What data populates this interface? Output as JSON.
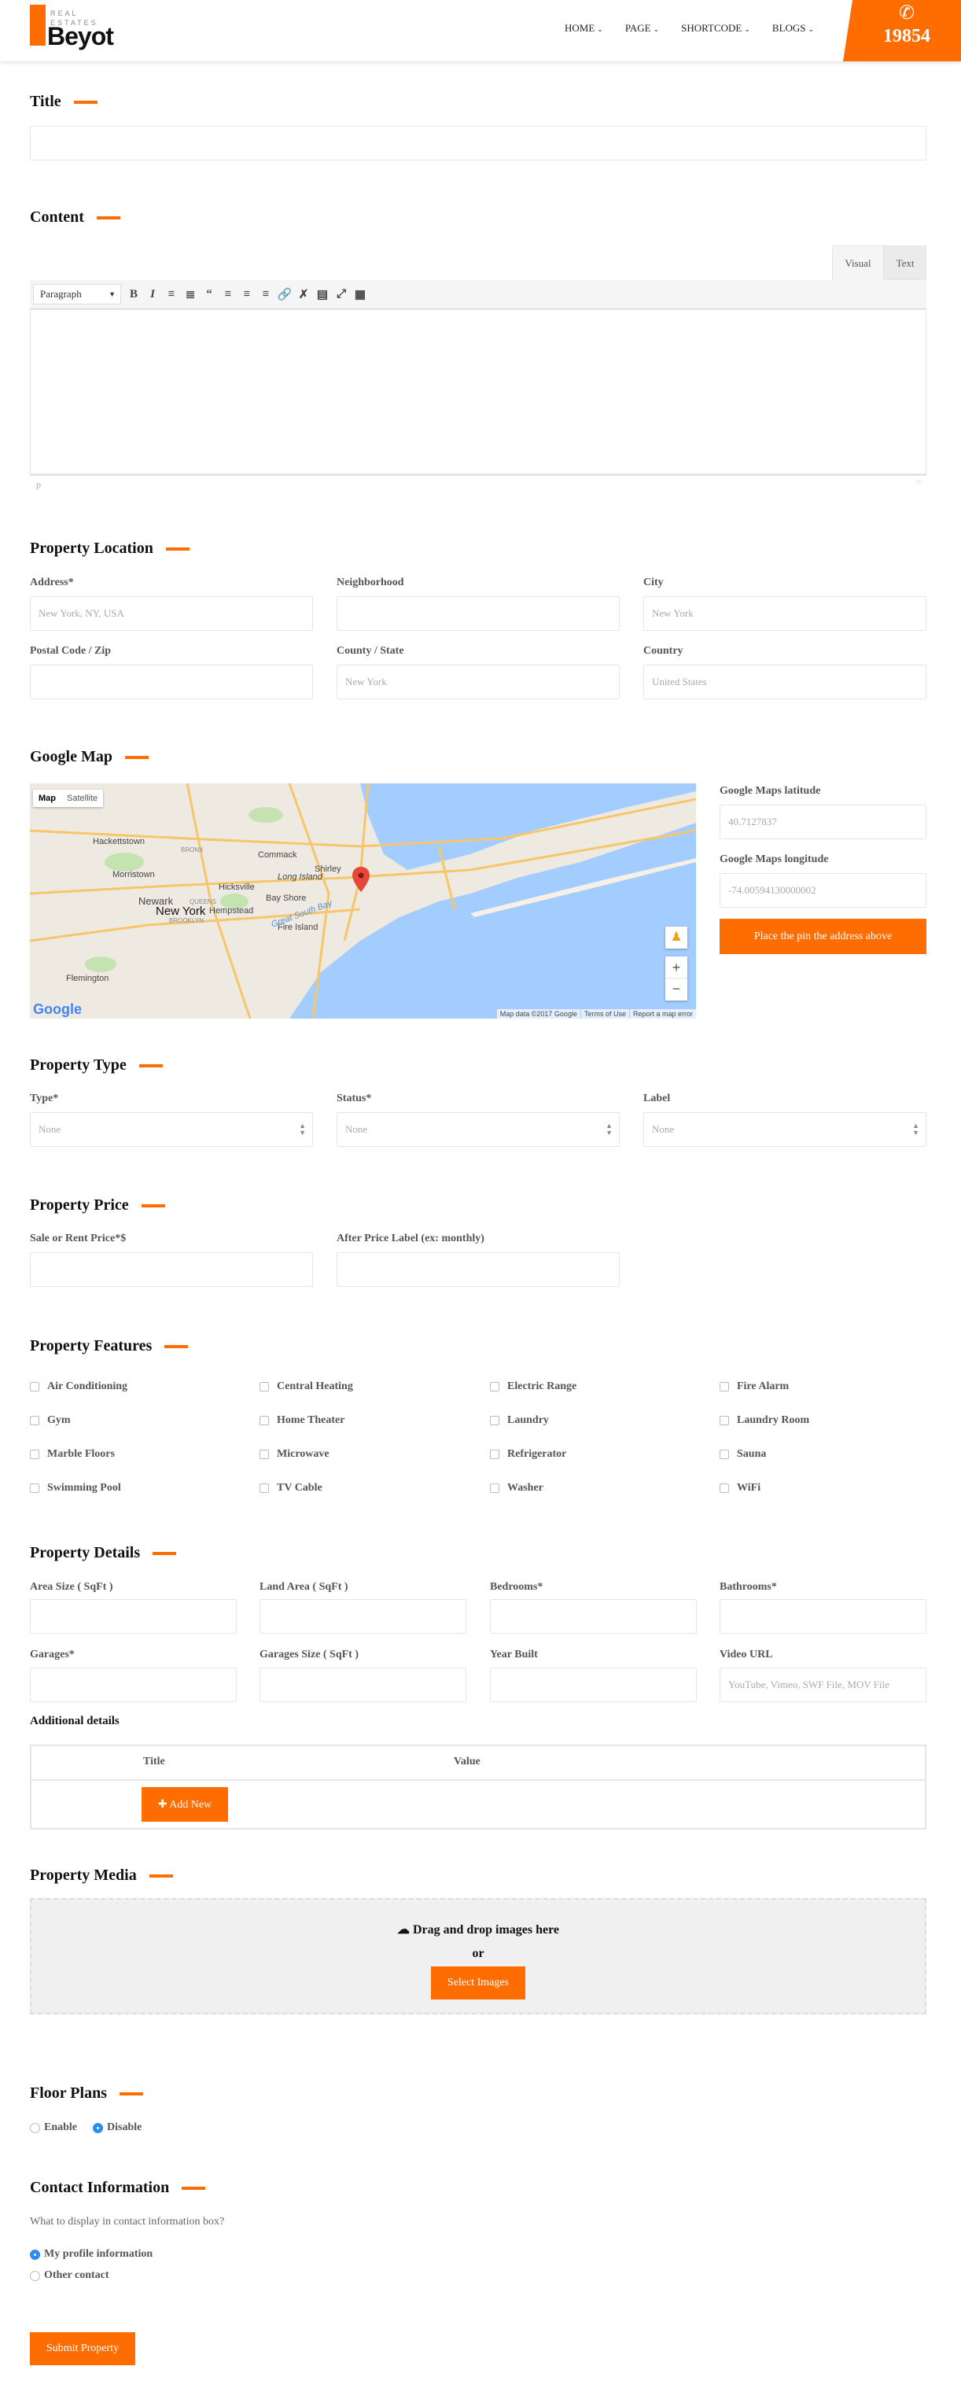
{
  "header": {
    "logo": {
      "line1": "REAL",
      "line2": "ESTATES",
      "name": "Beyot"
    },
    "nav": [
      {
        "label": "HOME"
      },
      {
        "label": "PAGE"
      },
      {
        "label": "SHORTCODE"
      },
      {
        "label": "BLOGS"
      }
    ],
    "phone": {
      "icon": "phone-icon",
      "number": "19854"
    }
  },
  "accent_color": "#ff6c00",
  "title_section": {
    "heading": "Title",
    "value": ""
  },
  "content_section": {
    "heading": "Content",
    "tabs": [
      {
        "label": "Visual",
        "active": true
      },
      {
        "label": "Text",
        "active": false
      }
    ],
    "format_select": "Paragraph",
    "toolbar": [
      "bold",
      "italic",
      "bullet-list",
      "numbered-list",
      "blockquote",
      "align-left",
      "align-center",
      "align-right",
      "link",
      "unlink",
      "read-more",
      "fullscreen",
      "toolbar-toggle"
    ],
    "path": "p"
  },
  "location": {
    "heading": "Property Location",
    "fields": [
      {
        "label": "Address*",
        "placeholder": "New York, NY, USA"
      },
      {
        "label": "Neighborhood",
        "placeholder": ""
      },
      {
        "label": "City",
        "placeholder": "New York"
      },
      {
        "label": "Postal Code / Zip",
        "placeholder": ""
      },
      {
        "label": "County / State",
        "placeholder": "New York"
      },
      {
        "label": "Country",
        "placeholder": "United States"
      }
    ]
  },
  "google_map": {
    "heading": "Google Map",
    "map_type_tabs": [
      "Map",
      "Satellite"
    ],
    "labels": [
      "Hackettstown",
      "Morristown",
      "Newark",
      "New York",
      "BRONX",
      "QUEENS",
      "BROOKLYN",
      "Hicksville",
      "Hempstead",
      "Commack",
      "Long Island",
      "Bay Shore",
      "Shirley",
      "Fire Island",
      "Great South Bay",
      "Flemington"
    ],
    "attribution": [
      "Map data ©2017 Google",
      "Terms of Use",
      "Report a map error"
    ],
    "google_logo": "Google",
    "zoom_in": "+",
    "zoom_out": "−",
    "latitude_label": "Google Maps latitude",
    "latitude_value": "40.7127837",
    "longitude_label": "Google Maps longitude",
    "longitude_value": "-74.00594130000002",
    "place_pin_button": "Place the pin the address above"
  },
  "property_type": {
    "heading": "Property Type",
    "fields": [
      {
        "label": "Type*",
        "value": "None"
      },
      {
        "label": "Status*",
        "value": "None"
      },
      {
        "label": "Label",
        "value": "None"
      }
    ]
  },
  "property_price": {
    "heading": "Property Price",
    "fields": [
      {
        "label": "Sale or Rent Price*$",
        "value": ""
      },
      {
        "label": "After Price Label (ex: monthly)",
        "value": ""
      }
    ]
  },
  "features": {
    "heading": "Property Features",
    "items": [
      "Air Conditioning",
      "Central Heating",
      "Electric Range",
      "Fire Alarm",
      "Gym",
      "Home Theater",
      "Laundry",
      "Laundry Room",
      "Marble Floors",
      "Microwave",
      "Refrigerator",
      "Sauna",
      "Swimming Pool",
      "TV Cable",
      "Washer",
      "WiFi"
    ]
  },
  "details": {
    "heading": "Property Details",
    "fields": [
      {
        "label": "Area Size ( SqFt )",
        "placeholder": ""
      },
      {
        "label": "Land Area ( SqFt )",
        "placeholder": ""
      },
      {
        "label": "Bedrooms*",
        "placeholder": ""
      },
      {
        "label": "Bathrooms*",
        "placeholder": ""
      },
      {
        "label": "Garages*",
        "placeholder": ""
      },
      {
        "label": "Garages Size ( SqFt )",
        "placeholder": ""
      },
      {
        "label": "Year Built",
        "placeholder": ""
      },
      {
        "label": "Video URL",
        "placeholder": "YouTube, Vimeo, SWF File, MOV File"
      }
    ],
    "additional_heading": "Additional details",
    "table_headers": [
      "Title",
      "Value"
    ],
    "add_new_button": "Add New"
  },
  "media": {
    "heading": "Property Media",
    "drop_text": "Drag and drop images here",
    "or_text": "or",
    "select_button": "Select Images"
  },
  "floor_plans": {
    "heading": "Floor Plans",
    "options": [
      {
        "label": "Enable",
        "checked": false
      },
      {
        "label": "Disable",
        "checked": true
      }
    ]
  },
  "contact": {
    "heading": "Contact Information",
    "question": "What to display in contact information box?",
    "options": [
      {
        "label": "My profile information",
        "checked": true
      },
      {
        "label": "Other contact",
        "checked": false
      }
    ]
  },
  "submit_button": "Submit Property"
}
